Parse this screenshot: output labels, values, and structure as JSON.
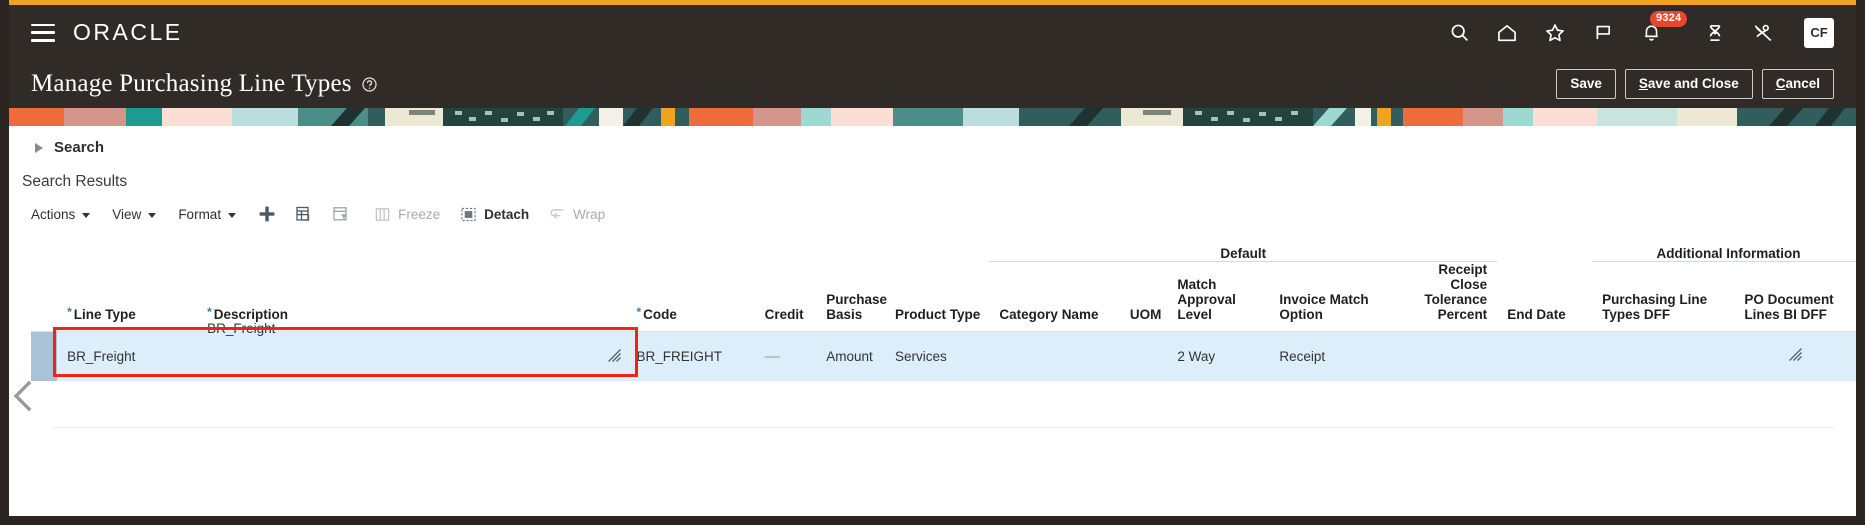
{
  "theme": {
    "accent_bar": "#f0a31e",
    "header_bg": "#312b27",
    "badge_color": "#e8462e",
    "row_selected_bg": "#ddeefb",
    "highlight_box": "#ee2512",
    "required_star": "#2f7ac7"
  },
  "global_header": {
    "brand": "ORACLE",
    "page_title": "Manage Purchasing Line Types",
    "icons": [
      {
        "name": "search-icon",
        "label": "Search"
      },
      {
        "name": "home-icon",
        "label": "Home"
      },
      {
        "name": "favorites-star-icon",
        "label": "Favorites and Recent Items"
      },
      {
        "name": "flag-icon",
        "label": "Watchlist"
      },
      {
        "name": "notifications-bell-icon",
        "label": "Notifications",
        "badge": "9324"
      },
      {
        "name": "settings-actions-icon",
        "label": "Settings and Actions"
      },
      {
        "name": "accessibility-icon",
        "label": "Accessibility"
      }
    ],
    "avatar_initials": "CF",
    "buttons": [
      {
        "name": "save-button",
        "label": "Save"
      },
      {
        "name": "save-and-close-button",
        "label": "Save and Close"
      },
      {
        "name": "cancel-button",
        "label": "Cancel"
      }
    ]
  },
  "search_section": {
    "label": "Search",
    "results_label": "Search Results"
  },
  "table_toolbar": {
    "menus": [
      {
        "name": "actions-menu",
        "label": "Actions"
      },
      {
        "name": "view-menu",
        "label": "View"
      },
      {
        "name": "format-menu",
        "label": "Format"
      }
    ],
    "icon_buttons": [
      {
        "name": "add-row-icon",
        "label": "Add Row"
      },
      {
        "name": "duplicate-row-icon",
        "label": "Duplicate Row"
      },
      {
        "name": "query-by-example-icon",
        "label": "Query By Example"
      }
    ],
    "text_buttons": [
      {
        "name": "freeze-button",
        "label": "Freeze",
        "enabled": false
      },
      {
        "name": "detach-button",
        "label": "Detach",
        "enabled": true
      },
      {
        "name": "wrap-button",
        "label": "Wrap",
        "enabled": false
      }
    ]
  },
  "table": {
    "column_groups": [
      {
        "name": "default-group",
        "label": "Default"
      },
      {
        "name": "additional-information-group",
        "label": "Additional Information"
      }
    ],
    "columns": [
      {
        "key": "line_type",
        "label": "Line Type",
        "required": true,
        "align": "left"
      },
      {
        "key": "description",
        "label": "Description",
        "required": true,
        "align": "left"
      },
      {
        "key": "code",
        "label": "Code",
        "required": true,
        "align": "left"
      },
      {
        "key": "credit",
        "label": "Credit",
        "required": false,
        "align": "left"
      },
      {
        "key": "purchase_basis",
        "label": "Purchase Basis",
        "required": false,
        "align": "left"
      },
      {
        "key": "product_type",
        "label": "Product Type",
        "required": false,
        "align": "left"
      },
      {
        "key": "category_name",
        "label": "Category Name",
        "required": false,
        "align": "left"
      },
      {
        "key": "uom",
        "label": "UOM",
        "required": false,
        "align": "left"
      },
      {
        "key": "match_approval",
        "label": "Match Approval Level",
        "required": false,
        "align": "left"
      },
      {
        "key": "invoice_match",
        "label": "Invoice Match Option",
        "required": false,
        "align": "left"
      },
      {
        "key": "receipt_close",
        "label": "Receipt Close Tolerance Percent",
        "required": false,
        "align": "right"
      },
      {
        "key": "end_date",
        "label": "End Date",
        "required": false,
        "align": "left"
      },
      {
        "key": "purchasing_dff",
        "label": "Purchasing Line Types DFF",
        "required": false,
        "align": "left"
      },
      {
        "key": "po_bi_dff",
        "label": "PO Document Lines BI DFF",
        "required": false,
        "align": "left"
      }
    ],
    "rows": [
      {
        "line_type": "BR_Freight",
        "description": "BR_Freight",
        "code": "BR_FREIGHT",
        "credit": "—",
        "purchase_basis": "Amount",
        "product_type": "Services",
        "category_name": "",
        "uom": "",
        "match_approval": "2 Way",
        "invoice_match": "Receipt",
        "receipt_close": "",
        "end_date": "",
        "purchasing_dff": "",
        "po_bi_dff": "",
        "selected": true
      }
    ]
  }
}
